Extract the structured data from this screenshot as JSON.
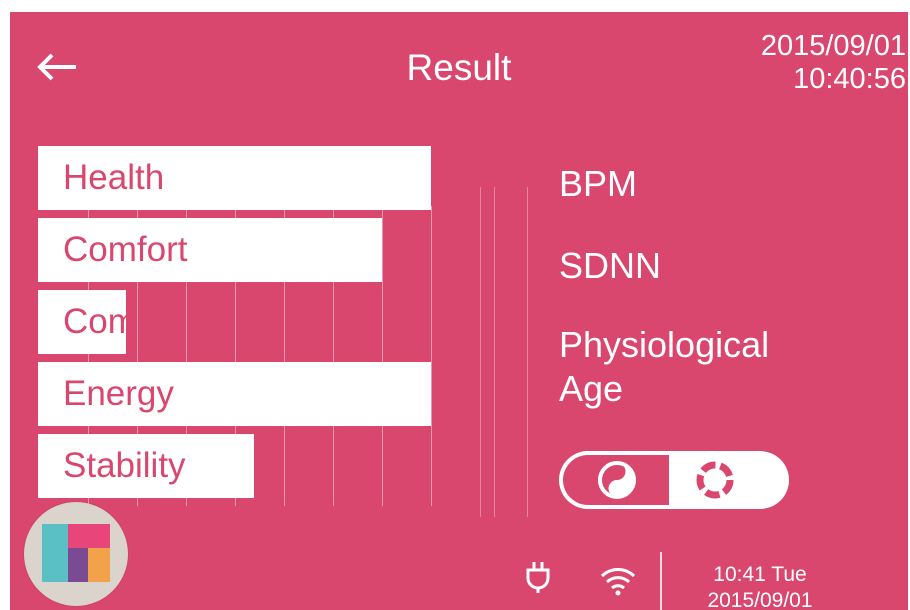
{
  "header": {
    "back_icon": "arrow-left-icon",
    "title": "Result",
    "date": "2015/09/01",
    "time": "10:40:56"
  },
  "bars": [
    {
      "label": "Health",
      "level": 1.0
    },
    {
      "label": "Comfort",
      "level": 0.875
    },
    {
      "label": "Combat",
      "level": 0.225
    },
    {
      "label": "Energy",
      "level": 1.0
    },
    {
      "label": "Stability",
      "level": 0.55
    }
  ],
  "metrics": {
    "bpm_label": "BPM",
    "sdnn_label": "SDNN",
    "physio_line1": "Physiological",
    "physio_line2": "Age"
  },
  "toggle": {
    "left_icon": "yin-yang-icon",
    "right_icon": "ring-icon"
  },
  "home_button_icon": "app-grid-icon",
  "status_bar": {
    "power_icon": "power-plug-icon",
    "wifi_icon": "wifi-icon",
    "clock_time": "10:41 Tue",
    "clock_date": "2015/09/01"
  },
  "colors": {
    "background": "#d9476f",
    "foreground": "#ffffff",
    "home_button_bg": "#dad4cd",
    "tile_teal": "#5bc0c5",
    "tile_pink": "#e8467a",
    "tile_purple": "#7a4a92",
    "tile_orange": "#f2a24a"
  }
}
